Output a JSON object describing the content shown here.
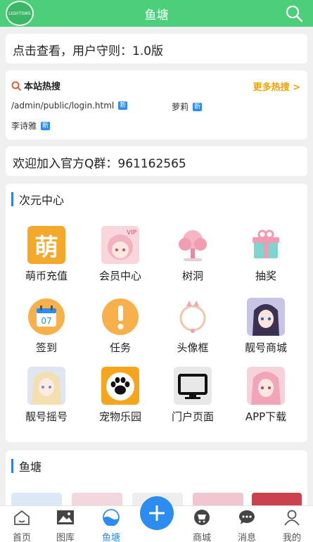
{
  "header": {
    "logo_text": "LIGHTSWS",
    "title": "鱼塘"
  },
  "notice": "点击查看，用户守则：1.0版",
  "hot": {
    "title": "本站热搜",
    "more": "更多热搜 >",
    "items": [
      {
        "text": "/admin/public/login.html",
        "badge": "新"
      },
      {
        "text": "萝莉",
        "badge": "新"
      },
      {
        "text": "李诗雅",
        "badge": "新"
      }
    ]
  },
  "qq_group": "欢迎加入官方Q群：961162565",
  "center": {
    "title": "次元中心",
    "items": [
      {
        "label": "萌币充值",
        "icon": "meng-coin-icon"
      },
      {
        "label": "会员中心",
        "icon": "anime-avatar-pink-icon"
      },
      {
        "label": "树洞",
        "icon": "pink-tree-icon"
      },
      {
        "label": "抽奖",
        "icon": "gift-box-icon"
      },
      {
        "label": "签到",
        "icon": "calendar-icon"
      },
      {
        "label": "任务",
        "icon": "exclamation-icon"
      },
      {
        "label": "头像框",
        "icon": "avatar-frame-icon"
      },
      {
        "label": "靓号商城",
        "icon": "anime-girl-dark-icon"
      },
      {
        "label": "靓号摇号",
        "icon": "anime-girl-blonde-icon"
      },
      {
        "label": "宠物乐园",
        "icon": "paw-icon"
      },
      {
        "label": "门户页面",
        "icon": "monitor-icon"
      },
      {
        "label": "APP下载",
        "icon": "anime-girl-pink-icon"
      }
    ]
  },
  "fish": {
    "title": "鱼塘"
  },
  "calendar_day": "07",
  "meng_char": "萌",
  "tabs": [
    {
      "label": "首页",
      "icon": "home-icon"
    },
    {
      "label": "图库",
      "icon": "gallery-icon"
    },
    {
      "label": "鱼塘",
      "icon": "pond-icon",
      "active": true
    },
    {
      "label": "商城",
      "icon": "cart-icon"
    },
    {
      "label": "消息",
      "icon": "message-icon"
    },
    {
      "label": "我的",
      "icon": "user-icon"
    }
  ],
  "colors": {
    "header_green": "#4ccf7a",
    "accent_blue": "#2d8cf0",
    "more_orange": "#f5a200"
  }
}
